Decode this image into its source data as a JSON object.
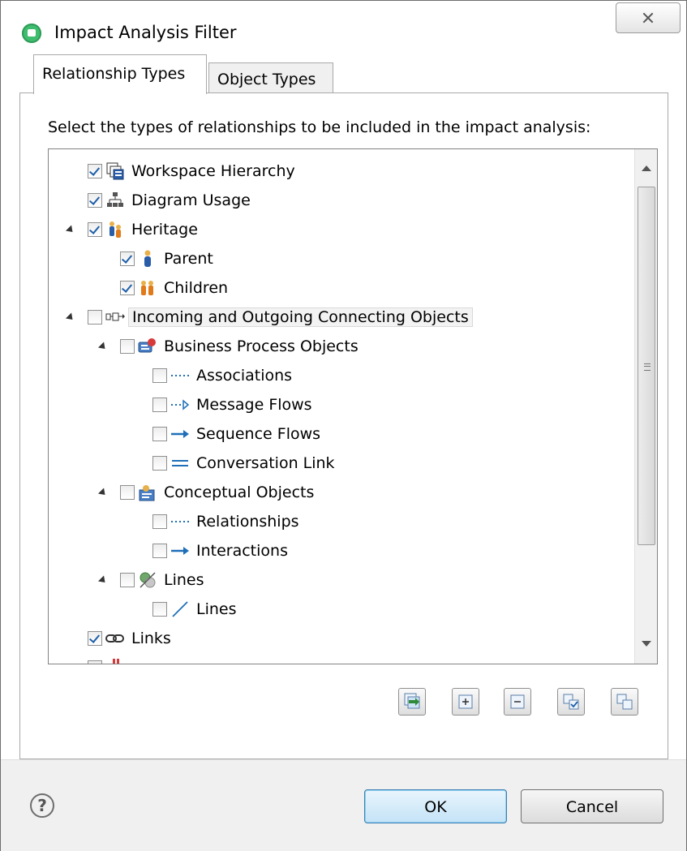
{
  "window": {
    "title": "Impact Analysis Filter"
  },
  "tabs": [
    {
      "label": "Relationship Types",
      "active": true
    },
    {
      "label": "Object Types",
      "active": false
    }
  ],
  "instruction": "Select the types of relationships to be included in the impact analysis:",
  "tree": [
    {
      "label": "Workspace Hierarchy",
      "checked": true,
      "icon": "workspace-hierarchy-icon"
    },
    {
      "label": "Diagram Usage",
      "checked": true,
      "icon": "diagram-usage-icon"
    },
    {
      "label": "Heritage",
      "checked": true,
      "icon": "heritage-icon",
      "expanded": true
    },
    {
      "label": "Parent",
      "checked": true,
      "icon": "parent-icon"
    },
    {
      "label": "Children",
      "checked": true,
      "icon": "children-icon"
    },
    {
      "label": "Incoming and Outgoing Connecting Objects",
      "checked": false,
      "icon": "connecting-objects-icon",
      "expanded": true,
      "selected": true
    },
    {
      "label": "Business Process Objects",
      "checked": false,
      "icon": "business-process-icon",
      "expanded": true
    },
    {
      "label": "Associations",
      "checked": false,
      "icon": "dotted-line-icon"
    },
    {
      "label": "Message Flows",
      "checked": false,
      "icon": "message-flow-icon"
    },
    {
      "label": "Sequence Flows",
      "checked": false,
      "icon": "arrow-right-icon"
    },
    {
      "label": "Conversation Link",
      "checked": false,
      "icon": "double-line-icon"
    },
    {
      "label": "Conceptual Objects",
      "checked": false,
      "icon": "conceptual-objects-icon",
      "expanded": true
    },
    {
      "label": "Relationships",
      "checked": false,
      "icon": "dotted-line-icon"
    },
    {
      "label": "Interactions",
      "checked": false,
      "icon": "arrow-right-icon"
    },
    {
      "label": "Lines",
      "checked": false,
      "icon": "lines-group-icon",
      "expanded": true
    },
    {
      "label": "Lines",
      "checked": false,
      "icon": "diagonal-line-icon"
    },
    {
      "label": "Links",
      "checked": true,
      "icon": "link-icon"
    }
  ],
  "toolbar": [
    "reset-icon",
    "expand-all-icon",
    "collapse-all-icon",
    "select-all-icon",
    "deselect-all-icon"
  ],
  "footer": {
    "help_symbol": "?",
    "ok_label": "OK",
    "cancel_label": "Cancel"
  },
  "colors": {
    "ok_border": "#3c7fb1",
    "check": "#1d5fa8",
    "arrow": "#1e6fb8",
    "app_icon": "#3fbd6e"
  }
}
